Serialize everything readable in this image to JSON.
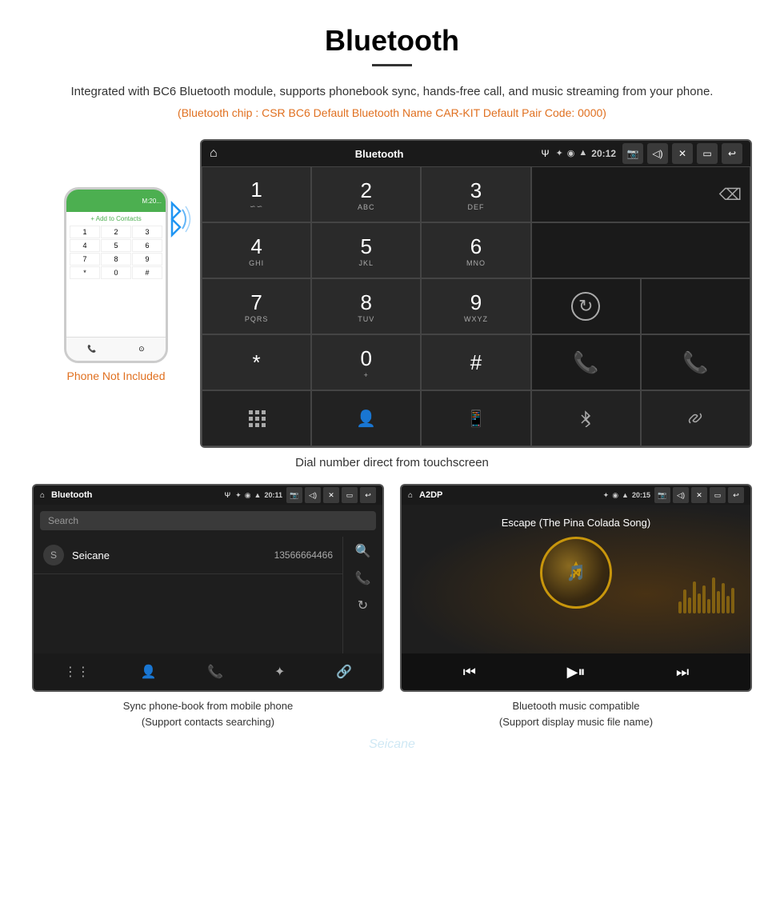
{
  "header": {
    "title": "Bluetooth",
    "divider": true,
    "description": "Integrated with BC6 Bluetooth module, supports phonebook sync, hands-free call, and music streaming from your phone.",
    "specs": "(Bluetooth chip : CSR BC6   Default Bluetooth Name CAR-KIT   Default Pair Code: 0000)"
  },
  "main_screen": {
    "status_bar": {
      "home_icon": "⌂",
      "title": "Bluetooth",
      "usb_icon": "Ψ",
      "bluetooth_icon": "✦",
      "location_icon": "◉",
      "signal_icon": "▲",
      "time": "20:12",
      "camera_icon": "📷",
      "volume_icon": "◁)",
      "close_icon": "✕",
      "window_icon": "▭",
      "back_icon": "↩"
    },
    "dialpad": {
      "keys": [
        {
          "num": "1",
          "sub": "∽∽",
          "col": 1,
          "row": 1
        },
        {
          "num": "2",
          "sub": "ABC",
          "col": 2,
          "row": 1
        },
        {
          "num": "3",
          "sub": "DEF",
          "col": 3,
          "row": 1
        },
        {
          "num": "4",
          "sub": "GHI",
          "col": 1,
          "row": 2
        },
        {
          "num": "5",
          "sub": "JKL",
          "col": 2,
          "row": 2
        },
        {
          "num": "6",
          "sub": "MNO",
          "col": 3,
          "row": 2
        },
        {
          "num": "7",
          "sub": "PQRS",
          "col": 1,
          "row": 3
        },
        {
          "num": "8",
          "sub": "TUV",
          "col": 2,
          "row": 3
        },
        {
          "num": "9",
          "sub": "WXYZ",
          "col": 3,
          "row": 3
        },
        {
          "num": "*",
          "sub": "",
          "col": 1,
          "row": 4
        },
        {
          "num": "0",
          "sub": "+",
          "col": 2,
          "row": 4
        },
        {
          "num": "#",
          "sub": "",
          "col": 3,
          "row": 4
        }
      ]
    }
  },
  "caption_main": "Dial number direct from touchscreen",
  "phone_label": "Phone Not Included",
  "bottom_left": {
    "status_bar": {
      "title": "Bluetooth",
      "time": "20:11"
    },
    "search_placeholder": "Search",
    "contact": {
      "initial": "S",
      "name": "Seicane",
      "phone": "13566664466"
    },
    "caption_line1": "Sync phone-book from mobile phone",
    "caption_line2": "(Support contacts searching)"
  },
  "bottom_right": {
    "status_bar": {
      "title": "A2DP",
      "time": "20:15"
    },
    "song_title": "Escape (The Pina Colada Song)",
    "caption_line1": "Bluetooth music compatible",
    "caption_line2": "(Support display music file name)"
  },
  "watermark": "Seicane",
  "colors": {
    "accent_orange": "#e07020",
    "android_dark": "#2a2a2a",
    "green_call": "#4caf50",
    "red_call": "#f44336",
    "gold": "#c8960c"
  }
}
